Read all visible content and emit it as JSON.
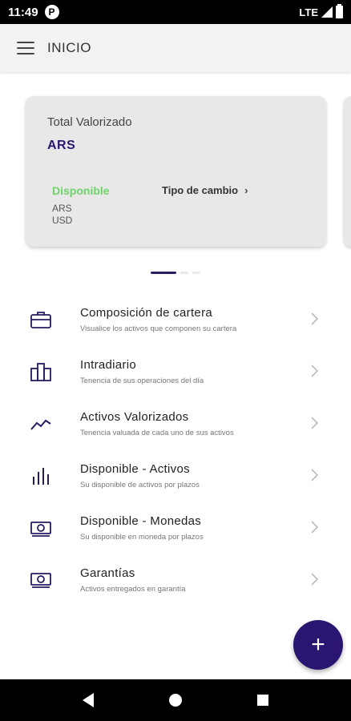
{
  "status_bar": {
    "time": "11:49",
    "app_icon": "P",
    "network": "LTE"
  },
  "app_bar": {
    "title": "INICIO"
  },
  "card": {
    "total_label": "Total Valorizado",
    "currency": "ARS",
    "disponible_label": "Disponible",
    "ars_label": "ARS",
    "usd_label": "USD",
    "tipo_cambio_label": "Tipo de cambio",
    "chevron": "›"
  },
  "menu": {
    "items": [
      {
        "label": "Composición de cartera",
        "sub": "Visualice los activos que componen su cartera",
        "icon": "briefcase-icon"
      },
      {
        "label": "Intradiario",
        "sub": "Tenencia de sus operaciones del día",
        "icon": "buildings-icon"
      },
      {
        "label": "Activos Valorizados",
        "sub": "Tenencia valuada de cada uno de sus activos",
        "icon": "trend-line-icon"
      },
      {
        "label": "Disponible - Activos",
        "sub": "Su disponible de activos por plazos",
        "icon": "bar-chart-icon"
      },
      {
        "label": "Disponible - Monedas",
        "sub": "Su disponible en moneda por plazos",
        "icon": "cash-icon"
      },
      {
        "label": "Garantías",
        "sub": "Activos entregados en garantía",
        "icon": "cash-stack-icon"
      }
    ]
  },
  "fab": {
    "label": "+"
  },
  "colors": {
    "accent": "#2a1670",
    "green": "#6fd26a",
    "icon": "#2a1a60"
  }
}
